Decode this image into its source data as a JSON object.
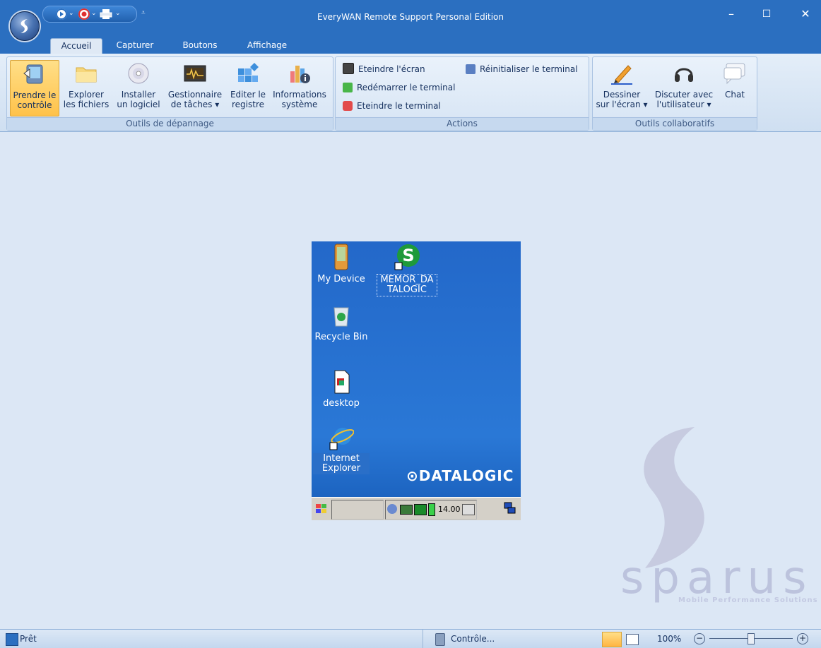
{
  "window": {
    "title": "EveryWAN Remote Support Personal Edition",
    "minimize": "–",
    "maximize": "☐",
    "close": "✕"
  },
  "tabs": [
    "Accueil",
    "Capturer",
    "Boutons",
    "Affichage"
  ],
  "ribbon": {
    "depannage": {
      "title": "Outils de dépannage",
      "buttons": [
        {
          "l1": "Prendre le",
          "l2": "contrôle"
        },
        {
          "l1": "Explorer",
          "l2": "les fichiers"
        },
        {
          "l1": "Installer",
          "l2": "un logiciel"
        },
        {
          "l1": "Gestionnaire",
          "l2": "de tâches ▾"
        },
        {
          "l1": "Editer le",
          "l2": "registre"
        },
        {
          "l1": "Informations",
          "l2": "système"
        }
      ]
    },
    "actions": {
      "title": "Actions",
      "eteindre_ecran": "Eteindre l'écran",
      "redemarrer": "Redémarrer le terminal",
      "eteindre_terminal": "Eteindre le terminal",
      "reinitialiser": "Réinitialiser le terminal"
    },
    "collab": {
      "title": "Outils collaboratifs",
      "dessiner": {
        "l1": "Dessiner",
        "l2": "sur l'écran ▾"
      },
      "discuter": {
        "l1": "Discuter avec",
        "l2": "l'utilisateur ▾"
      },
      "chat": "Chat"
    }
  },
  "device": {
    "icons": {
      "my_device": "My Device",
      "memor": "MEMOR_DA TALOGIC",
      "recycle": "Recycle Bin",
      "desktop": "desktop",
      "ie": "Internet Explorer"
    },
    "brand": "⊙DATALOGIC",
    "clock": "14.00"
  },
  "sparus": {
    "word": "sparus",
    "tagline": "Mobile Performance Solutions"
  },
  "statusbar": {
    "status": "Prêt",
    "mode": "Contrôle...",
    "zoom": "100%"
  }
}
